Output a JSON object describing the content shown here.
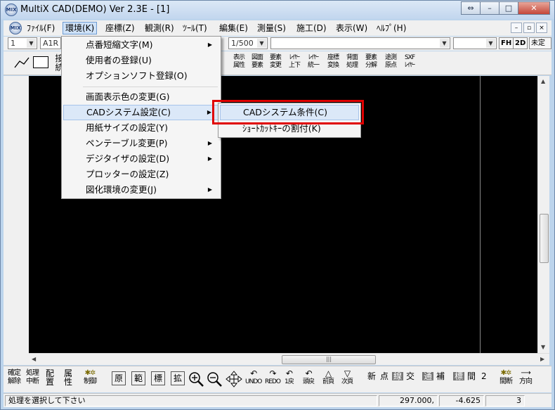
{
  "window": {
    "title": "MultiX CAD(DEMO)   Ver 2.3E - [1]",
    "app_icon_text": "MIX",
    "buttons": {
      "restore": "⇔",
      "minimize": "–",
      "maximize": "□",
      "close": "✕"
    }
  },
  "menubar": {
    "items": [
      {
        "label": "ﾌｧｲﾙ(F)"
      },
      {
        "label": "環境(K)",
        "active": true
      },
      {
        "label": "座標(Z)"
      },
      {
        "label": "観測(R)"
      },
      {
        "label": "ﾂｰﾙ(T)"
      },
      {
        "label": "編集(E)"
      },
      {
        "label": "測量(S)"
      },
      {
        "label": "施工(D)"
      },
      {
        "label": "表示(W)"
      },
      {
        "label": "ﾍﾙﾌﾟ(H)"
      }
    ],
    "mdi": {
      "minimize": "–",
      "restore": "▫",
      "close": "×"
    }
  },
  "toolbar1": {
    "layer_value": "1",
    "paper_value": "A1R",
    "scale_value": "1/500",
    "fh_label": "FH",
    "d2_label": "2D",
    "undetermined": "未定義"
  },
  "toolbar2": {
    "tools": [
      {
        "top": "表示",
        "bottom": "属性"
      },
      {
        "top": "図面",
        "bottom": "要素"
      },
      {
        "top": "要素",
        "bottom": "変更"
      },
      {
        "top": "ﾚｲﾔｰ",
        "bottom": "上下"
      },
      {
        "top": "ﾚｲﾔｰ",
        "bottom": "統一"
      },
      {
        "top": "座標",
        "bottom": "変換"
      },
      {
        "top": "背面",
        "bottom": "処理"
      },
      {
        "top": "要素",
        "bottom": "分解"
      },
      {
        "top": "途測",
        "bottom": "原点"
      },
      {
        "top": "SXF",
        "bottom": "ﾚｲﾔｰ"
      }
    ],
    "partial_label_top": "接",
    "partial_label_bottom": "続"
  },
  "dropdown": {
    "items": [
      {
        "label": "点番短縮文字(M)",
        "submenu": true
      },
      {
        "label": "使用者の登録(U)",
        "submenu": false
      },
      {
        "label": "オプションソフト登録(O)",
        "submenu": false
      },
      {
        "label": "画面表示色の変更(G)",
        "submenu": false
      },
      {
        "label": "CADシステム設定(C)",
        "submenu": true,
        "highlighted": true
      },
      {
        "label": "用紙サイズの設定(Y)",
        "submenu": false
      },
      {
        "label": "ペンテーブル変更(P)",
        "submenu": true
      },
      {
        "label": "デジタイザの設定(D)",
        "submenu": true
      },
      {
        "label": "プロッターの設定(Z)",
        "submenu": false
      },
      {
        "label": "図化環境の変更(J)",
        "submenu": true
      }
    ]
  },
  "submenu": {
    "items": [
      {
        "label": "CADシステム条件(C)",
        "highlighted": true
      },
      {
        "label": "ｼｮｰﾄｶｯﾄｷｰの割付(K)",
        "highlighted": false
      }
    ]
  },
  "bottombar": {
    "stacked": [
      {
        "top": "確定",
        "bottom": "解除"
      },
      {
        "top": "処理",
        "bottom": "中断"
      },
      {
        "top": "配",
        "bottom": "置"
      },
      {
        "top": "属",
        "bottom": "性"
      },
      {
        "top": "✱✲",
        "bottom": "制御"
      }
    ],
    "boxed": [
      "原",
      "範",
      "標",
      "拡"
    ],
    "nav": [
      {
        "icon": "↶",
        "label": "UNDO"
      },
      {
        "icon": "↷",
        "label": "REDO"
      },
      {
        "icon": "↶",
        "label": "1戻"
      },
      {
        "icon": "↶",
        "label": "頭戻"
      },
      {
        "icon": "△",
        "label": "前頁"
      },
      {
        "icon": "▽",
        "label": "次頁"
      }
    ],
    "modes": [
      "新",
      "点",
      "線",
      "交",
      "通",
      "補",
      "標",
      "間",
      "2"
    ],
    "dark_modes": [
      "線",
      "通",
      "標"
    ],
    "right_tools": [
      {
        "top": "✱✲",
        "bottom": "間断"
      },
      {
        "top": "⟶",
        "bottom": "方向"
      }
    ]
  },
  "statusbar": {
    "message": "処理を選択して下さい",
    "x": "297.000,",
    "y": "-4.625",
    "layer": "3"
  },
  "colors": {
    "highlight_outline": "#e00000",
    "canvas": "#000000"
  }
}
